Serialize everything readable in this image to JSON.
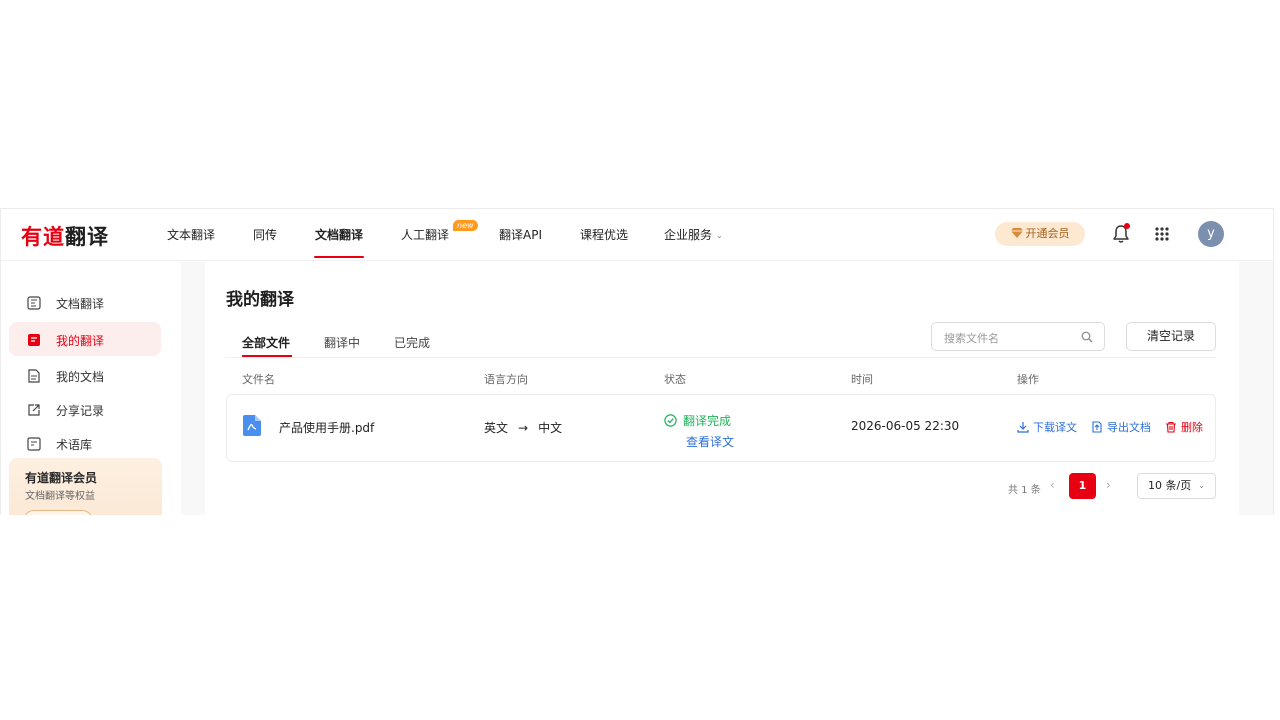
{
  "header": {
    "logo_red": "有道",
    "logo_dark": "翻译",
    "nav": [
      {
        "label": "文本翻译"
      },
      {
        "label": "同传"
      },
      {
        "label": "文档翻译"
      },
      {
        "label": "人工翻译"
      },
      {
        "label": "翻译API"
      },
      {
        "label": "课程优选"
      },
      {
        "label": "企业服务"
      }
    ],
    "active_nav": "文档翻译",
    "new_badge": "new",
    "vip_label": "开通会员",
    "avatar_letter": "y"
  },
  "sidebar": {
    "items": [
      {
        "label": "文档翻译",
        "icon": "document-translate-icon"
      },
      {
        "label": "我的翻译",
        "icon": "my-translations-icon"
      },
      {
        "label": "我的文档",
        "icon": "my-documents-icon"
      },
      {
        "label": "分享记录",
        "icon": "share-icon"
      },
      {
        "label": "术语库",
        "icon": "glossary-icon"
      }
    ],
    "active_item": "我的翻译",
    "member_card": {
      "title": "有道翻译会员",
      "subtitle": "文档翻译等权益"
    }
  },
  "main": {
    "title": "我的翻译",
    "tabs": [
      {
        "label": "全部文件"
      },
      {
        "label": "翻译中"
      },
      {
        "label": "已完成"
      }
    ],
    "active_tab": "全部文件",
    "search_placeholder": "搜索文件名",
    "clear_label": "清空记录",
    "table": {
      "headers": [
        "文件名",
        "语言方向",
        "状态",
        "时间",
        "操作"
      ],
      "rows": [
        {
          "file_name": "产品使用手册.pdf",
          "source_lang": "英文",
          "arrow": "→",
          "target_lang": "中文",
          "status": "翻译完成",
          "view_link": "查看译文",
          "time": "2026-06-05 22:30",
          "actions": {
            "download": "下载译文",
            "export": "导出文档",
            "delete": "删除"
          }
        }
      ]
    },
    "pagination": {
      "total": "共 1 条",
      "current_page": "1",
      "page_size": "10 条/页"
    }
  },
  "colors": {
    "brand_red": "#e60012",
    "link_blue": "#2f6fd8",
    "success_green": "#1fb55a",
    "vip_bg": "#fde8d2"
  }
}
